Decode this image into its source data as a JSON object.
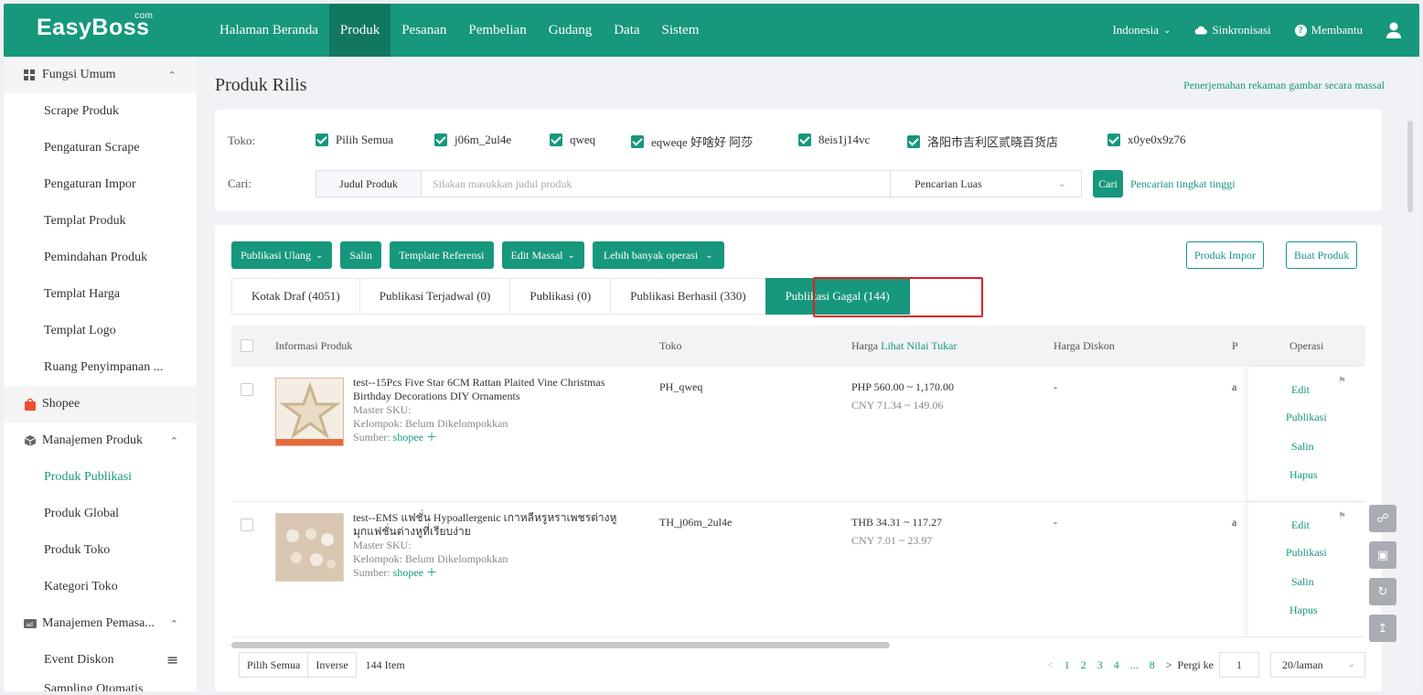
{
  "topbar": {
    "logo": "EasyBoss",
    "logo_sup": "com",
    "nav": [
      "Halaman Beranda",
      "Produk",
      "Pesanan",
      "Pembelian",
      "Gudang",
      "Data",
      "Sistem"
    ],
    "active_nav": "Produk",
    "region": "Indonesia",
    "sync": "Sinkronisasi",
    "help": "Membantu"
  },
  "sidebar": {
    "group_general": "Fungsi Umum",
    "general_items": [
      "Scrape Produk",
      "Pengaturan Scrape",
      "Pengaturan Impor",
      "Templat Produk",
      "Pemindahan Produk",
      "Templat Harga",
      "Templat Logo",
      "Ruang Penyimpanan ..."
    ],
    "shopee": "Shopee",
    "group_product": "Manajemen Produk",
    "product_items": [
      "Produk Publikasi",
      "Produk Global",
      "Produk Toko",
      "Kategori Toko"
    ],
    "group_marketing": "Manajemen Pemasa...",
    "marketing_items": [
      "Event Diskon",
      "Sampling Otomatis"
    ]
  },
  "page": {
    "title": "Produk Rilis",
    "top_link": "Penerjemahan rekaman gambar secara massal"
  },
  "filter": {
    "store_label": "Toko:",
    "stores": [
      "Pilih Semua",
      "j06m_2ul4e",
      "qweq",
      "eqweqe 好啥好 阿莎",
      "8eis1j14vc",
      "洛阳市吉利区贰晓百货店",
      "x0ye0x9z76"
    ],
    "search_label": "Cari:",
    "search_field": "Judul Produk",
    "search_placeholder": "Silakan masukkan judul produk",
    "search_mode": "Pencarian Luas",
    "search_button": "Cari",
    "advanced": "Pencarian tingkat tinggi"
  },
  "toolbar": {
    "republish": "Publikasi Ulang",
    "copy": "Salin",
    "template_ref": "Template Referensi",
    "bulk_edit": "Edit Massal",
    "more": "Lebih banyak operasi",
    "import": "Produk Impor",
    "create": "Buat Produk"
  },
  "tabs": [
    "Kotak Draf (4051)",
    "Publikasi Terjadwal (0)",
    "Publikasi (0)",
    "Publikasi Berhasil (330)",
    "Publikasi Gagal (144)"
  ],
  "table": {
    "headers": {
      "info": "Informasi Produk",
      "store": "Toko",
      "price": "Harga",
      "price_link": "Lihat Nilai Tukar",
      "discount": "Harga Diskon",
      "p": "P",
      "ops": "Operasi"
    },
    "rows": [
      {
        "title": "test--15Pcs Five Star 6CM Rattan Plaited Vine Christmas Birthday Decorations DIY Ornaments",
        "sku": "Master SKU:",
        "group": "Kelompok:   Belum Dikelompokkan",
        "source_label": "Sumber:",
        "source": "shopee",
        "store": "PH_qweq",
        "price": "PHP 560.00 ~ 1,170.00",
        "price_cny": "CNY 71.34 ~ 149.06",
        "discount": "-",
        "p": "a"
      },
      {
        "title": "test--EMS แฟชั่น Hypoallergenic เกาหลีหรูหราเพชรต่างหูมุกแฟชั่นต่างหูที่เรียบง่าย",
        "sku": "Master SKU:",
        "group": "Kelompok:   Belum Dikelompokkan",
        "source_label": "Sumber:",
        "source": "shopee",
        "store": "TH_j06m_2ul4e",
        "price": "THB 34.31 ~ 117.27",
        "price_cny": "CNY 7.01 ~ 23.97",
        "discount": "-",
        "p": "a"
      }
    ],
    "ops": [
      "Edit",
      "Publikasi",
      "Salin",
      "Hapus"
    ]
  },
  "footer": {
    "select_all": "Pilih Semua",
    "inverse": "Inverse",
    "count": "144 Item",
    "pages": [
      "1",
      "2",
      "3",
      "4",
      "...",
      "8"
    ],
    "goto": "Pergi ke",
    "goto_value": "1",
    "per_page": "20/laman"
  }
}
